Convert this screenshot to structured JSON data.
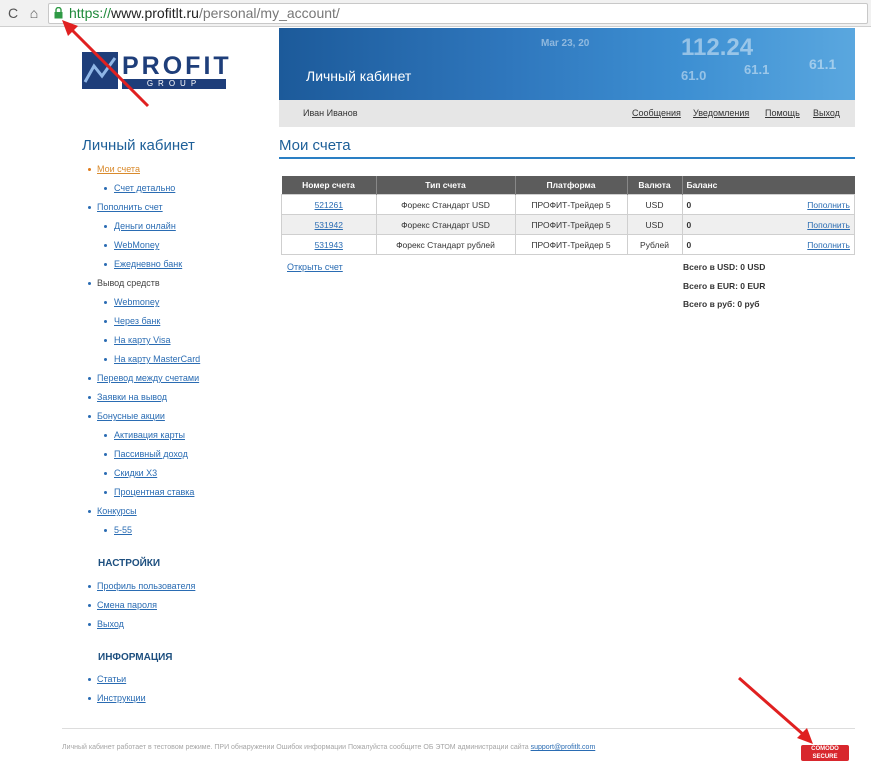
{
  "browser": {
    "reload_icon": "C",
    "home_icon": "⌂",
    "url_scheme": "https://",
    "url_host": "www.profitlt.ru",
    "url_path": "/personal/my_account/"
  },
  "logo": {
    "word": "PROFIT",
    "sub": "GROUP"
  },
  "header": {
    "title": "Личный кабинет",
    "tickers": [
      "Mar 23, 20",
      "112.24",
      "61.0",
      "61.1",
      "61.1"
    ]
  },
  "userbar": {
    "name": "Иван Иванов",
    "links": [
      "Сообщения",
      "Уведомления",
      "Помощь",
      "Выход"
    ]
  },
  "sidebar": {
    "title": "Личный кабинет",
    "items": [
      {
        "label": "Мои счета"
      },
      {
        "label": "Счет детально"
      },
      {
        "label": "Пополнить счет"
      },
      {
        "label": "Деньги онлайн"
      },
      {
        "label": "WebMoney"
      },
      {
        "label": "Ежедневно банк"
      },
      {
        "label": "Вывод средств"
      },
      {
        "label": "Webmoney"
      },
      {
        "label": "Через банк"
      },
      {
        "label": "На карту Visa"
      },
      {
        "label": "На карту MasterCard"
      },
      {
        "label": "Перевод между счетами"
      },
      {
        "label": "Заявки на вывод"
      },
      {
        "label": "Бонусные акции"
      },
      {
        "label": "Активация карты"
      },
      {
        "label": "Пассивный доход"
      },
      {
        "label": "Скидки Х3"
      },
      {
        "label": "Процентная ставка"
      },
      {
        "label": "Конкурсы"
      },
      {
        "label": "5-55"
      }
    ],
    "settings_title": "НАСТРОЙКИ",
    "settings": [
      {
        "label": "Профиль пользователя"
      },
      {
        "label": "Смена пароля"
      },
      {
        "label": "Выход"
      }
    ],
    "info_title": "ИНФОРМАЦИЯ",
    "info": [
      {
        "label": "Статьи"
      },
      {
        "label": "Инструкции"
      }
    ]
  },
  "main": {
    "title": "Мои счета",
    "columns": [
      "Номер счета",
      "Тип счета",
      "Платформа",
      "Валюта",
      "Баланс"
    ],
    "rows": [
      {
        "number": "521261",
        "type": "Форекс Стандарт USD",
        "platform": "ПРОФИТ-Трейдер 5",
        "currency": "USD",
        "balance": "0",
        "action": "Пополнить"
      },
      {
        "number": "531942",
        "type": "Форекс Стандарт USD",
        "platform": "ПРОФИТ-Трейдер 5",
        "currency": "USD",
        "balance": "0",
        "action": "Пополнить"
      },
      {
        "number": "531943",
        "type": "Форекс Стандарт рублей",
        "platform": "ПРОФИТ-Трейдер 5",
        "currency": "Рублей",
        "balance": "0",
        "action": "Пополнить"
      }
    ],
    "open_account": "Открыть счет",
    "totals": [
      "Всего в USD: 0 USD",
      "Всего в EUR: 0 EUR",
      "Всего в руб: 0 руб"
    ]
  },
  "footer": {
    "text": "Личный кабинет работает в тестовом режиме. ПРИ обнаружении Ошибок информации Пожалуйста сообщите ОБ ЭТОМ администрации сайта",
    "email": "support@profitlt.com",
    "badge_top": "COMODO",
    "badge_bottom": "SECURE"
  },
  "colors": {
    "accent": "#1d5f98",
    "link": "#2a6cb3",
    "annotation_arrow": "#e02020"
  }
}
